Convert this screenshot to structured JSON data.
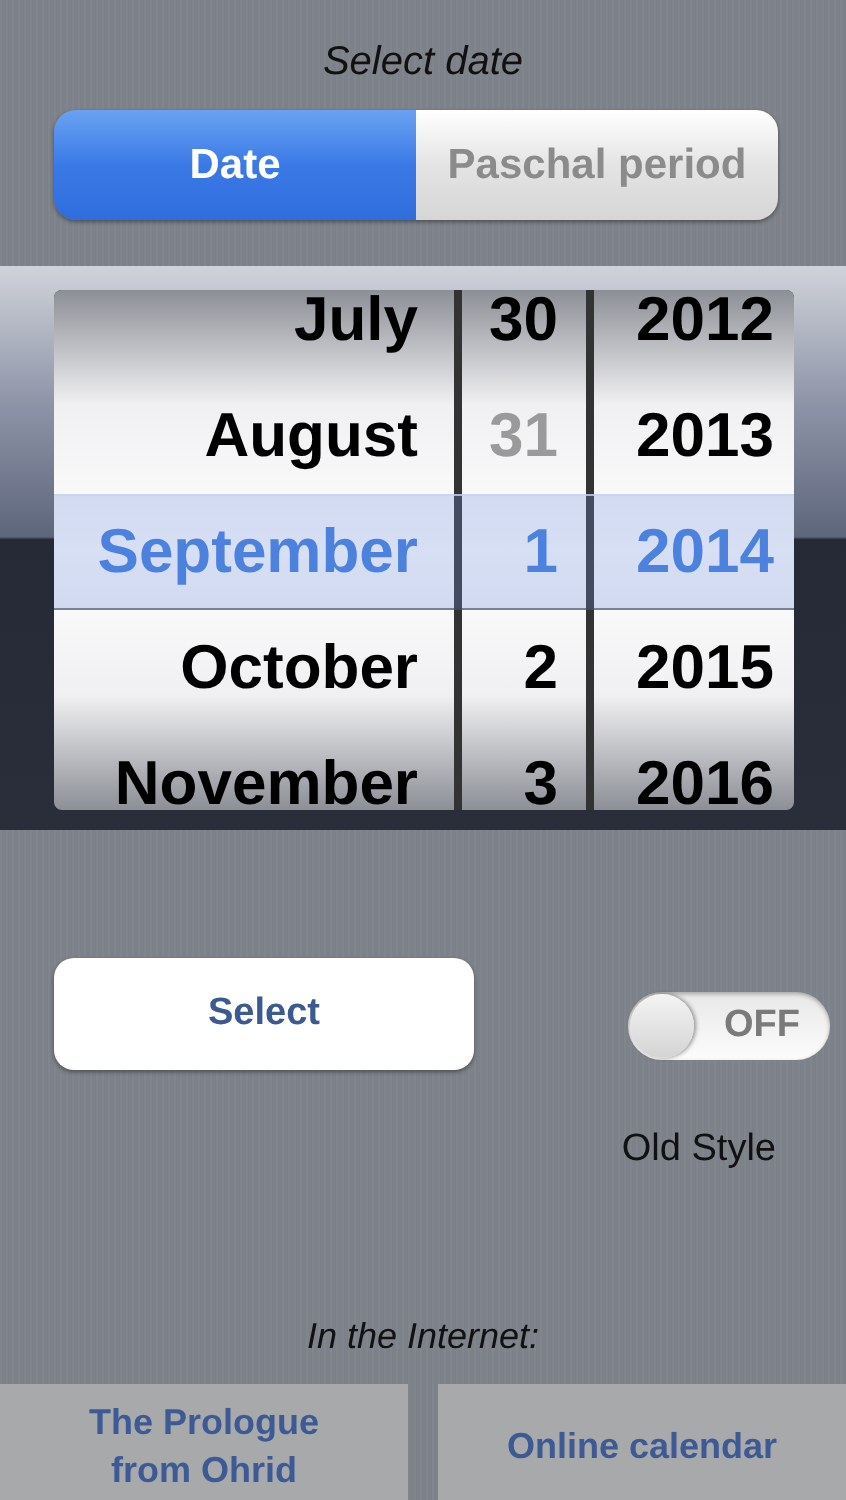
{
  "header": {
    "title": "Select date"
  },
  "segments": [
    {
      "label": "Date",
      "selected": true
    },
    {
      "label": "Paschal period",
      "selected": false
    }
  ],
  "picker": {
    "columns": [
      {
        "kind": "month",
        "rows": [
          {
            "text": "July",
            "selected": false,
            "disabled": false
          },
          {
            "text": "August",
            "selected": false,
            "disabled": false
          },
          {
            "text": "September",
            "selected": true,
            "disabled": false
          },
          {
            "text": "October",
            "selected": false,
            "disabled": false
          },
          {
            "text": "November",
            "selected": false,
            "disabled": false
          }
        ]
      },
      {
        "kind": "day",
        "rows": [
          {
            "text": "30",
            "selected": false,
            "disabled": false
          },
          {
            "text": "31",
            "selected": false,
            "disabled": true
          },
          {
            "text": "1",
            "selected": true,
            "disabled": false
          },
          {
            "text": "2",
            "selected": false,
            "disabled": false
          },
          {
            "text": "3",
            "selected": false,
            "disabled": false
          }
        ]
      },
      {
        "kind": "year",
        "rows": [
          {
            "text": "2012",
            "selected": false,
            "disabled": false
          },
          {
            "text": "2013",
            "selected": false,
            "disabled": false
          },
          {
            "text": "2014",
            "selected": true,
            "disabled": false
          },
          {
            "text": "2015",
            "selected": false,
            "disabled": false
          },
          {
            "text": "2016",
            "selected": false,
            "disabled": false
          }
        ]
      }
    ]
  },
  "select_button": {
    "label": "Select"
  },
  "old_style": {
    "toggle_text": "OFF",
    "on": false,
    "label": "Old Style"
  },
  "internet": {
    "heading": "In the Internet:",
    "links": [
      {
        "label": "The Prologue from Ohrid"
      },
      {
        "label": "Online calendar"
      }
    ]
  }
}
